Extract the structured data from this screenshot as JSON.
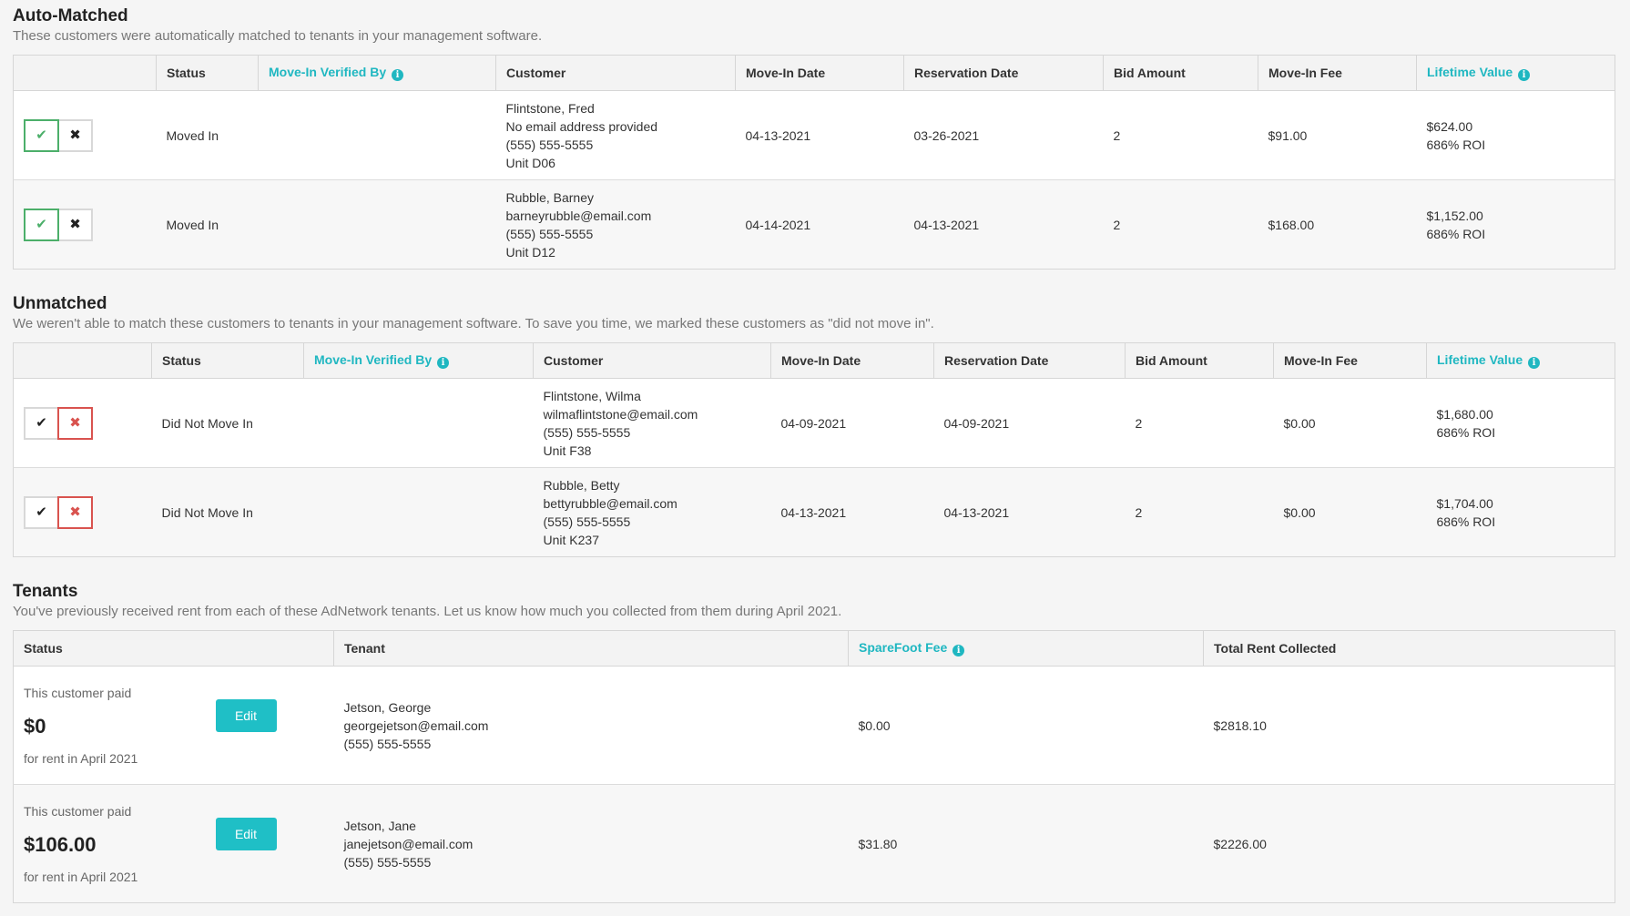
{
  "auto_matched": {
    "title": "Auto-Matched",
    "description": "These customers were automatically matched to tenants in your management software.",
    "headers": {
      "status": "Status",
      "verified_by": "Move-In Verified By",
      "customer": "Customer",
      "move_in_date": "Move-In Date",
      "reservation_date": "Reservation Date",
      "bid_amount": "Bid Amount",
      "move_in_fee": "Move-In Fee",
      "lifetime_value": "Lifetime Value"
    },
    "rows": [
      {
        "status": "Moved In",
        "name": "Flintstone, Fred",
        "email": "No email address provided",
        "phone": "(555) 555-5555",
        "unit": "Unit D06",
        "move_in_date": "04-13-2021",
        "reservation_date": "03-26-2021",
        "bid_amount": "2",
        "move_in_fee": "$91.00",
        "lifetime_value": "$624.00",
        "roi": "686% ROI"
      },
      {
        "status": "Moved In",
        "name": "Rubble, Barney",
        "email": "barneyrubble@email.com",
        "phone": "(555) 555-5555",
        "unit": "Unit D12",
        "move_in_date": "04-14-2021",
        "reservation_date": "04-13-2021",
        "bid_amount": "2",
        "move_in_fee": "$168.00",
        "lifetime_value": "$1,152.00",
        "roi": "686% ROI"
      }
    ]
  },
  "unmatched": {
    "title": "Unmatched",
    "description": "We weren't able to match these customers to tenants in your management software. To save you time, we marked these customers as \"did not move in\".",
    "headers": {
      "status": "Status",
      "verified_by": "Move-In Verified By",
      "customer": "Customer",
      "move_in_date": "Move-In Date",
      "reservation_date": "Reservation Date",
      "bid_amount": "Bid Amount",
      "move_in_fee": "Move-In Fee",
      "lifetime_value": "Lifetime Value"
    },
    "rows": [
      {
        "status": "Did Not Move In",
        "name": "Flintstone, Wilma",
        "email": "wilmaflintstone@email.com",
        "phone": "(555) 555-5555",
        "unit": "Unit F38",
        "move_in_date": "04-09-2021",
        "reservation_date": "04-09-2021",
        "bid_amount": "2",
        "move_in_fee": "$0.00",
        "lifetime_value": "$1,680.00",
        "roi": "686% ROI"
      },
      {
        "status": "Did Not Move In",
        "name": "Rubble, Betty",
        "email": "bettyrubble@email.com",
        "phone": "(555) 555-5555",
        "unit": "Unit K237",
        "move_in_date": "04-13-2021",
        "reservation_date": "04-13-2021",
        "bid_amount": "2",
        "move_in_fee": "$0.00",
        "lifetime_value": "$1,704.00",
        "roi": "686% ROI"
      }
    ]
  },
  "tenants": {
    "title": "Tenants",
    "description": "You've previously received rent from each of these AdNetwork tenants. Let us know how much you collected from them during April 2021.",
    "headers": {
      "status": "Status",
      "tenant": "Tenant",
      "sparefoot_fee": "SpareFoot Fee",
      "total_rent": "Total Rent Collected"
    },
    "rows": [
      {
        "paid_label": "This customer paid",
        "amount": "$0",
        "period": "for rent in April 2021",
        "edit_label": "Edit",
        "name": "Jetson, George",
        "email": "georgejetson@email.com",
        "phone": "(555) 555-5555",
        "sparefoot_fee": "$0.00",
        "total_rent": "$2818.10"
      },
      {
        "paid_label": "This customer paid",
        "amount": "$106.00",
        "period": "for rent in April 2021",
        "edit_label": "Edit",
        "name": "Jetson, Jane",
        "email": "janejetson@email.com",
        "phone": "(555) 555-5555",
        "sparefoot_fee": "$31.80",
        "total_rent": "$2226.00"
      }
    ]
  },
  "icons": {
    "check": "✔",
    "cross": "✖",
    "info": "i"
  },
  "colors": {
    "accent": "#1fb7c1",
    "moved_in": "#3b9a52",
    "did_not_move_in": "#c7453f"
  }
}
